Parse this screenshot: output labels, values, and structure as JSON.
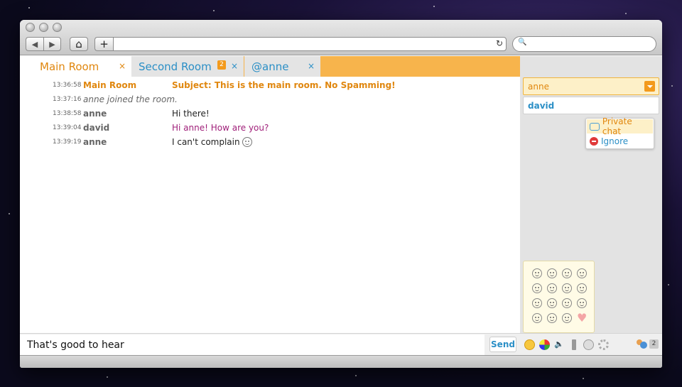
{
  "toolbar": {
    "back_icon": "◀",
    "forward_icon": "▶",
    "home_icon": "⌂",
    "add_tab_icon": "+",
    "reload_icon": "↻",
    "search_icon": "🔍"
  },
  "tabs": [
    {
      "label": "Main Room",
      "close": "×",
      "active": true
    },
    {
      "label": "Second Room",
      "badge": "2",
      "close": "×"
    },
    {
      "label": "@anne",
      "close": "×"
    }
  ],
  "messages": [
    {
      "time": "13:36:58",
      "nick": "Main Room",
      "text": "Subject: This is the main room. No Spamming!"
    },
    {
      "time": "13:37:16",
      "text": "anne joined the room."
    },
    {
      "time": "13:38:58",
      "nick": "anne",
      "text": "Hi there!"
    },
    {
      "time": "13:39:04",
      "nick": "david",
      "text": "Hi anne! How are you?"
    },
    {
      "time": "13:39:19",
      "nick": "anne",
      "text": "I can't complain"
    }
  ],
  "roster": {
    "users": [
      "anne",
      "david"
    ],
    "context_menu": {
      "private_chat": "Private chat",
      "ignore": "Ignore"
    }
  },
  "input": {
    "value": "That's good to hear",
    "send_label": "Send"
  },
  "user_count": "2",
  "colors": {
    "accent": "#f39a1c",
    "link": "#2b8fc6",
    "tab_bar": "#f7b44c"
  }
}
